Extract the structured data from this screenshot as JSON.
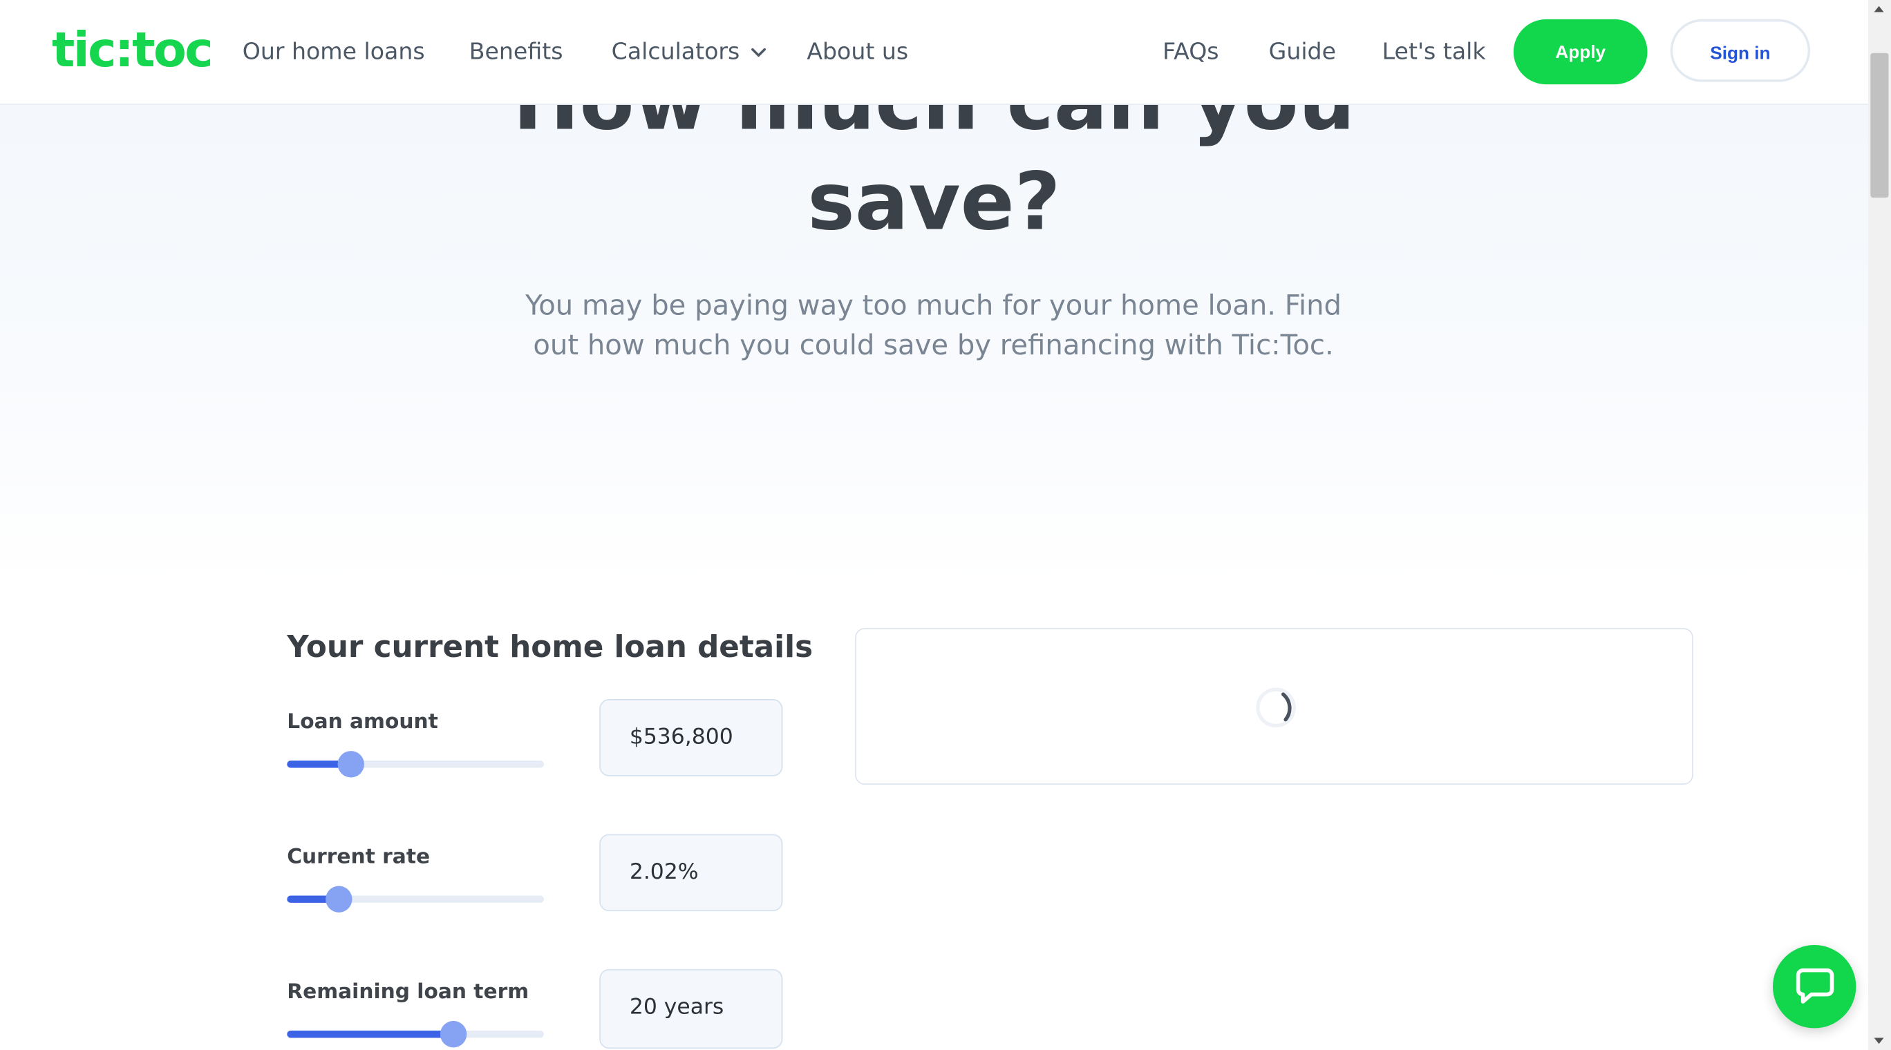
{
  "header": {
    "logo": "tic:toc",
    "nav": {
      "home_loans": "Our home loans",
      "benefits": "Benefits",
      "calculators": "Calculators",
      "about": "About us",
      "faqs": "FAQs",
      "guide": "Guide",
      "lets_talk": "Let's talk"
    },
    "apply_label": "Apply",
    "signin_label": "Sign in"
  },
  "hero": {
    "title_line1": "How much can you",
    "title_line2": "save?",
    "subtitle": "You may be paying way too much for your home loan. Find out how much you could save by refinancing with Tic:Toc."
  },
  "loan_details": {
    "title": "Your current home loan details",
    "fields": [
      {
        "label": "Loan amount",
        "value": "$536,800",
        "slider_fraction": 0.25
      },
      {
        "label": "Current rate",
        "value": "2.02%",
        "slider_fraction": 0.2
      },
      {
        "label": "Remaining loan term",
        "value": "20 years",
        "slider_fraction": 0.65
      }
    ]
  },
  "result": {
    "state": "loading"
  },
  "chat": {
    "icon": "chat-bubble-icon"
  },
  "colors": {
    "brand_green": "#12d64c",
    "slider_blue": "#3c63e6",
    "signin_blue": "#2454d6",
    "heading_dark": "#3b4149"
  }
}
